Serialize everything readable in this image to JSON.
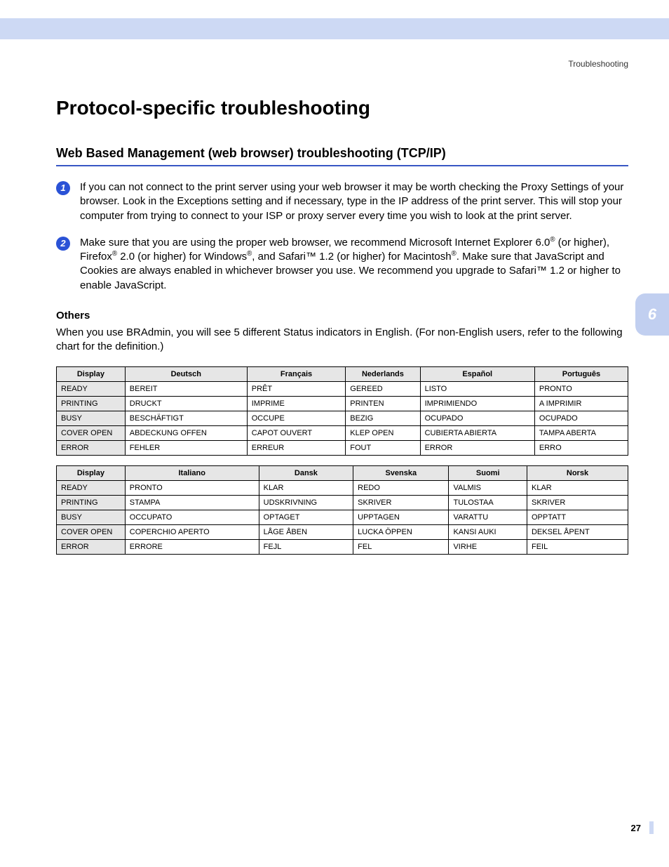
{
  "header": {
    "section": "Troubleshooting"
  },
  "title": "Protocol-specific troubleshooting",
  "subtitle": "Web Based Management (web browser) troubleshooting (TCP/IP)",
  "steps": {
    "s1": "If you can not connect to the print server using your web browser it may be worth checking the Proxy Settings of your browser. Look in the Exceptions setting and if necessary, type in the IP address of the print server. This will stop your computer from trying to connect to your ISP or proxy server every time you wish to look at the print server.",
    "s2_parts": {
      "a": "Make sure that you are using the proper web browser, we recommend Microsoft Internet Explorer 6.0",
      "b": " (or higher), Firefox",
      "c": " 2.0 (or higher) for Windows",
      "d": ", and Safari™ 1.2 (or higher) for Macintosh",
      "e": ". Make sure that JavaScript and Cookies are always enabled in whichever browser you use. We recommend you upgrade to Safari™ 1.2 or higher to enable JavaScript."
    }
  },
  "others": {
    "heading": "Others",
    "para": "When you use BRAdmin, you will see 5 different Status indicators in English. (For non-English users, refer to the following chart for the definition.)"
  },
  "table1": {
    "headers": [
      "Display",
      "Deutsch",
      "Français",
      "Nederlands",
      "Español",
      "Português"
    ],
    "rows": [
      [
        "READY",
        "BEREIT",
        "PRÊT",
        "GEREED",
        "LISTO",
        "PRONTO"
      ],
      [
        "PRINTING",
        "DRUCKT",
        "IMPRIME",
        "PRINTEN",
        "IMPRIMIENDO",
        "A IMPRIMIR"
      ],
      [
        "BUSY",
        "BESCHÄFTIGT",
        "OCCUPE",
        "BEZIG",
        "OCUPADO",
        "OCUPADO"
      ],
      [
        "COVER OPEN",
        "ABDECKUNG OFFEN",
        "CAPOT OUVERT",
        "KLEP OPEN",
        "CUBIERTA ABIERTA",
        "TAMPA ABERTA"
      ],
      [
        "ERROR",
        "FEHLER",
        "ERREUR",
        "FOUT",
        "ERROR",
        "ERRO"
      ]
    ]
  },
  "table2": {
    "headers": [
      "Display",
      "Italiano",
      "Dansk",
      "Svenska",
      "Suomi",
      "Norsk"
    ],
    "rows": [
      [
        "READY",
        "PRONTO",
        "KLAR",
        "REDO",
        "VALMIS",
        "KLAR"
      ],
      [
        "PRINTING",
        "STAMPA",
        "UDSKRIVNING",
        "SKRIVER",
        "TULOSTAA",
        "SKRIVER"
      ],
      [
        "BUSY",
        "OCCUPATO",
        "OPTAGET",
        "UPPTAGEN",
        "VARATTU",
        "OPPTATT"
      ],
      [
        "COVER OPEN",
        "COPERCHIO APERTO",
        "LÅGE ÅBEN",
        "LUCKA ÖPPEN",
        "KANSI AUKI",
        "DEKSEL ÅPENT"
      ],
      [
        "ERROR",
        "ERRORE",
        "FEJL",
        "FEL",
        "VIRHE",
        "FEIL"
      ]
    ]
  },
  "side_tab": "6",
  "page_number": "27",
  "reg_mark": "®"
}
